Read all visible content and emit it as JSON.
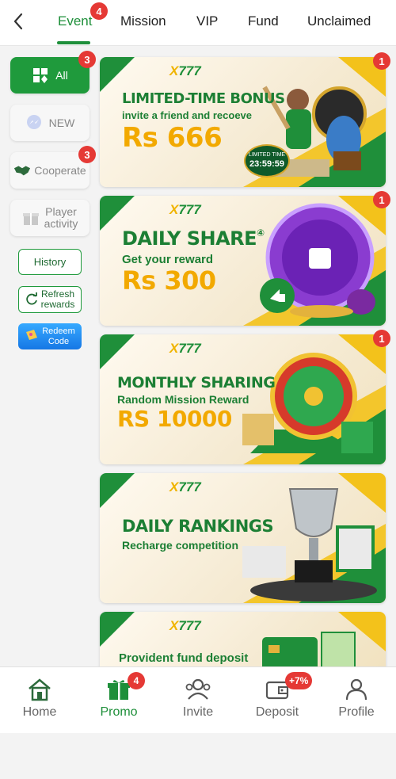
{
  "tabs": [
    {
      "label": "Event",
      "active": true,
      "badge": "4"
    },
    {
      "label": "Mission"
    },
    {
      "label": "VIP"
    },
    {
      "label": "Fund"
    },
    {
      "label": "Unclaimed"
    }
  ],
  "sidebar": {
    "categories": [
      {
        "label": "All",
        "badge": "3",
        "icon": "grid-icon",
        "active": true
      },
      {
        "label": "NEW",
        "icon": "messenger-icon"
      },
      {
        "label": "Cooperate",
        "badge": "3",
        "icon": "handshake-icon"
      },
      {
        "label_line1": "Player",
        "label_line2": "activity",
        "icon": "gift-icon"
      }
    ],
    "history": "History",
    "refresh_line1": "Refresh",
    "refresh_line2": "rewards",
    "redeem_line1": "Redeem",
    "redeem_line2": "Code"
  },
  "banners": [
    {
      "logo_x": "X",
      "logo_num": "777",
      "title": "LIMITED-TIME BONUS",
      "subtitle": "invite a friend and recoeve",
      "amount": "Rs 666",
      "badge": "1",
      "timer_label": "LIMITED TIME",
      "timer": "23:59:59"
    },
    {
      "logo_x": "X",
      "logo_num": "777",
      "title": "DAILY SHARE",
      "title_mark": "④",
      "subtitle": "Get your reward",
      "amount": "Rs 300",
      "badge": "1"
    },
    {
      "logo_x": "X",
      "logo_num": "777",
      "title": "MONTHLY SHARING",
      "subtitle": "Random Mission Reward",
      "amount": "RS 10000",
      "badge": "1"
    },
    {
      "logo_x": "X",
      "logo_num": "777",
      "title": "DAILY RANKINGS",
      "subtitle": "Recharge competition"
    },
    {
      "logo_x": "X",
      "logo_num": "777",
      "title": "Provident fund deposit"
    }
  ],
  "bottom_nav": [
    {
      "label": "Home",
      "icon": "home-icon"
    },
    {
      "label": "Promo",
      "icon": "gift-icon",
      "badge": "4",
      "active": true
    },
    {
      "label": "Invite",
      "icon": "users-icon"
    },
    {
      "label": "Deposit",
      "icon": "wallet-icon",
      "badge": "+7%"
    },
    {
      "label": "Profile",
      "icon": "person-icon"
    }
  ],
  "colors": {
    "brand_green": "#1e8f3a",
    "badge_red": "#e53935",
    "gold": "#f2a900"
  }
}
